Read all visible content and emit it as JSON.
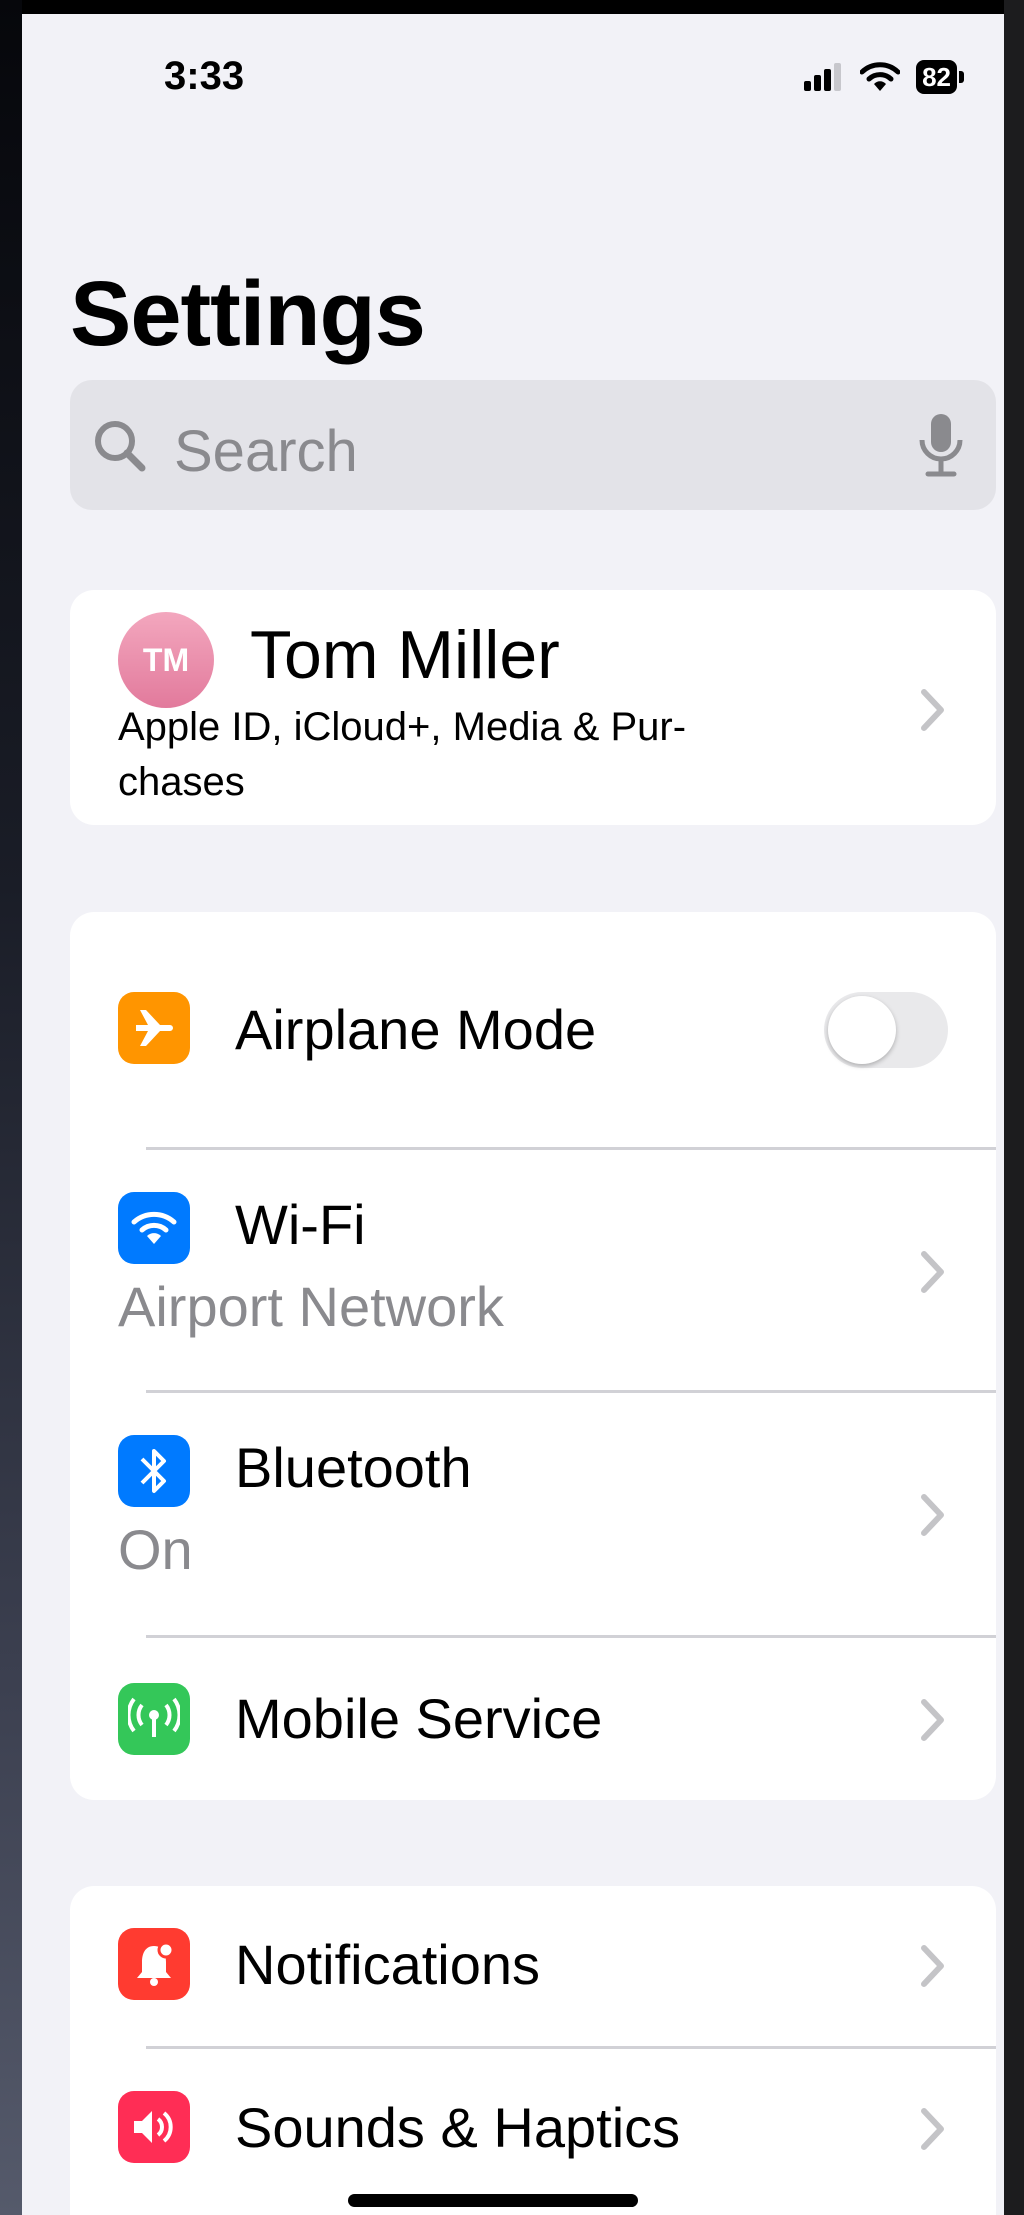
{
  "status_bar": {
    "time": "3:33",
    "battery": "82"
  },
  "title": "Settings",
  "search": {
    "placeholder": "Search"
  },
  "profile": {
    "initials": "TM",
    "name": "Tom Miller",
    "subtitle": "Apple ID, iCloud+, Media & Pur-\nchases"
  },
  "connectivity": [
    {
      "label": "Airplane Mode",
      "icon": "airplane-icon",
      "color": "#ff9500",
      "toggle_on": false
    },
    {
      "label": "Wi-Fi",
      "value": "Airport Network",
      "icon": "wifi-icon",
      "color": "#007aff"
    },
    {
      "label": "Bluetooth",
      "value": "On",
      "icon": "bluetooth-icon",
      "color": "#007aff"
    },
    {
      "label": "Mobile Service",
      "icon": "antenna-icon",
      "color": "#34c759"
    }
  ],
  "general": [
    {
      "label": "Notifications",
      "icon": "bell-icon",
      "color": "#ff3b30"
    },
    {
      "label": "Sounds & Haptics",
      "icon": "speaker-icon",
      "color": "#ff2d55"
    }
  ]
}
